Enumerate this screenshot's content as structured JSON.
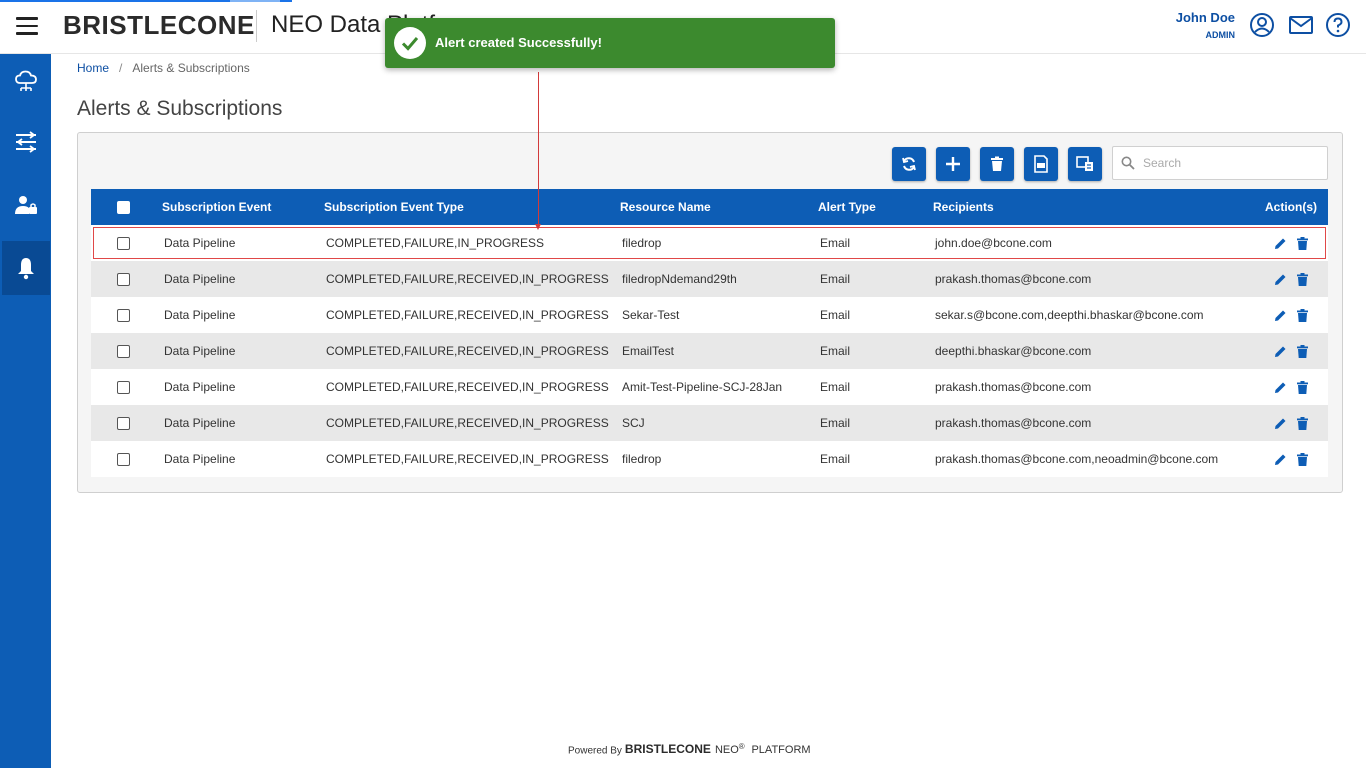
{
  "header": {
    "brand": "BRISTLECONE",
    "product": "NEO Data Platf",
    "user_name": "John Doe",
    "user_role": "ADMIN",
    "icons": [
      "account-icon",
      "mail-icon",
      "help-icon"
    ]
  },
  "sidebar": {
    "items": [
      {
        "icon": "cloud-network-icon",
        "active": false
      },
      {
        "icon": "pipeline-icon",
        "active": false
      },
      {
        "icon": "user-settings-icon",
        "active": false
      },
      {
        "icon": "bell-icon",
        "active": true
      }
    ]
  },
  "breadcrumb": {
    "home": "Home",
    "separator": "/",
    "current": "Alerts & Subscriptions"
  },
  "page": {
    "title": "Alerts & Subscriptions"
  },
  "toolbar": {
    "buttons": [
      "refresh-icon",
      "add-icon",
      "delete-icon",
      "export-xls-icon",
      "columns-icon"
    ],
    "search_placeholder": "Search"
  },
  "table": {
    "columns": [
      "Subscription Event",
      "Subscription Event Type",
      "Resource Name",
      "Alert Type",
      "Recipients",
      "Action(s)"
    ],
    "rows": [
      {
        "event": "Data Pipeline",
        "event_type": "COMPLETED,FAILURE,IN_PROGRESS",
        "resource": "filedrop",
        "alert_type": "Email",
        "recipients": "john.doe@bcone.com"
      },
      {
        "event": "Data Pipeline",
        "event_type": "COMPLETED,FAILURE,RECEIVED,IN_PROGRESS",
        "resource": "filedropNdemand29th",
        "alert_type": "Email",
        "recipients": "prakash.thomas@bcone.com"
      },
      {
        "event": "Data Pipeline",
        "event_type": "COMPLETED,FAILURE,RECEIVED,IN_PROGRESS",
        "resource": "Sekar-Test",
        "alert_type": "Email",
        "recipients": "sekar.s@bcone.com,deepthi.bhaskar@bcone.com"
      },
      {
        "event": "Data Pipeline",
        "event_type": "COMPLETED,FAILURE,RECEIVED,IN_PROGRESS",
        "resource": "EmailTest",
        "alert_type": "Email",
        "recipients": "deepthi.bhaskar@bcone.com"
      },
      {
        "event": "Data Pipeline",
        "event_type": "COMPLETED,FAILURE,RECEIVED,IN_PROGRESS",
        "resource": "Amit-Test-Pipeline-SCJ-28Jan",
        "alert_type": "Email",
        "recipients": "prakash.thomas@bcone.com"
      },
      {
        "event": "Data Pipeline",
        "event_type": "COMPLETED,FAILURE,RECEIVED,IN_PROGRESS",
        "resource": "SCJ",
        "alert_type": "Email",
        "recipients": "prakash.thomas@bcone.com"
      },
      {
        "event": "Data Pipeline",
        "event_type": "COMPLETED,FAILURE,RECEIVED,IN_PROGRESS",
        "resource": "filedrop",
        "alert_type": "Email",
        "recipients": "prakash.thomas@bcone.com,neoadmin@bcone.com"
      }
    ]
  },
  "toast": {
    "message": "Alert created Successfully!",
    "color": "#3c8a2e"
  },
  "footer": {
    "powered_by": "Powered By",
    "brand": "BRISTLECONE",
    "neo": "NEO",
    "registered": "®",
    "platform": "PLATFORM"
  },
  "colors": {
    "primary": "#0d5db5",
    "highlight_border": "#e04848"
  }
}
